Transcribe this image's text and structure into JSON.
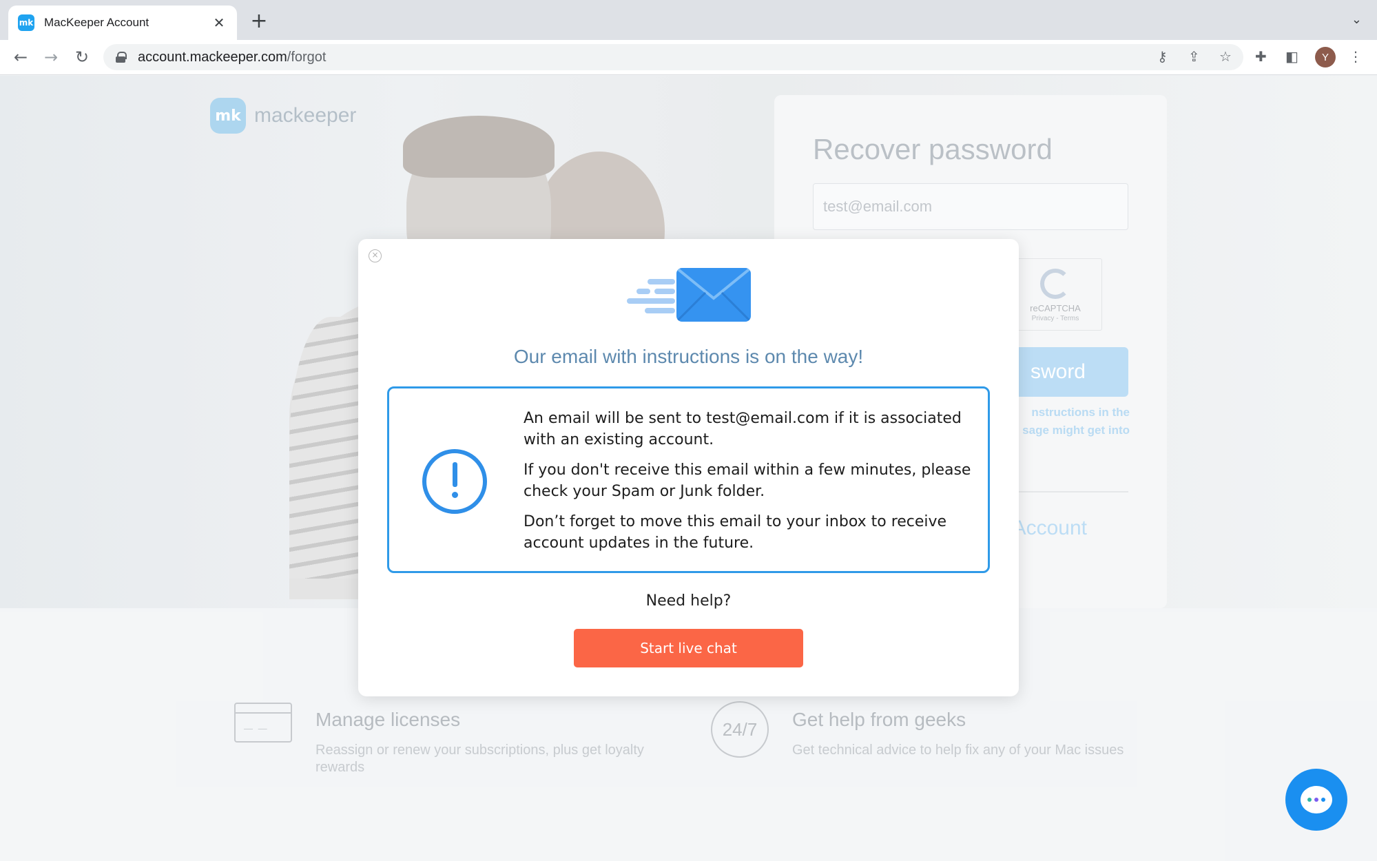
{
  "browser": {
    "tab_title": "MacKeeper Account",
    "favicon_text": "mk",
    "url_host": "account.mackeeper.com",
    "url_path": "/forgot",
    "avatar_initial": "Y"
  },
  "page": {
    "logo_mark": "mk",
    "logo_text": "mackeeper",
    "recover": {
      "title": "Recover password",
      "email_value": "test@email.com",
      "captcha_label": "reCAPTCHA",
      "captcha_terms": "Privacy - Terms",
      "button_label_partial": "sword",
      "note_line1": "nstructions in the",
      "note_line2": "sage might get into",
      "account_link_partial": "Account"
    },
    "features": [
      {
        "title": "Manage licenses",
        "desc": "Reassign or renew your subscriptions, plus get loyalty rewards",
        "icon": "card-icon"
      },
      {
        "title": "Get help from geeks",
        "desc": "Get technical advice to help fix any of your Mac issues",
        "icon_text": "24/7",
        "icon": "support-bubble-icon"
      }
    ]
  },
  "modal": {
    "heading": "Our email with instructions is on the way!",
    "paragraphs": [
      "An email will be sent to test@email.com if it is associated with an existing account.",
      "If you don't receive this email within a few minutes, please check your Spam or Junk folder.",
      "Don’t forget to move this email to your inbox to receive account updates in the future."
    ],
    "need_help": "Need help?",
    "chat_button": "Start live chat",
    "close_glyph": "×"
  },
  "colors": {
    "accent_blue": "#2f9ae8",
    "chat_orange": "#fb6646",
    "heading_blue": "#5d89ae",
    "fab_blue": "#1a8ff0"
  }
}
